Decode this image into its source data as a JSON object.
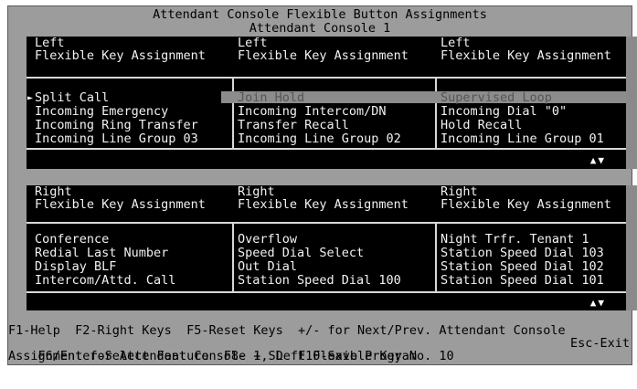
{
  "title": "Attendant Console Flexible Button Assignments",
  "subtitle": "Attendant Console 1",
  "left_panel": {
    "headers": [
      {
        "line1": "Left",
        "line2": "Flexible Key Assignment"
      },
      {
        "line1": "Left",
        "line2": "Flexible Key Assignment"
      },
      {
        "line1": "Left",
        "line2": "Flexible Key Assignment"
      }
    ],
    "columns": [
      [
        "Split Call",
        "Incoming Emergency",
        "Incoming Ring Transfer",
        "Incoming Line Group 03"
      ],
      [
        "Join Hold",
        "Incoming Intercom/DN",
        "Transfer Recall",
        "Incoming Line Group 02"
      ],
      [
        "Supervised Loop",
        "Incoming Dial \"0\"",
        "Hold Recall",
        "Incoming Line Group 01"
      ]
    ],
    "cursor_glyph": "►",
    "scroll_arrows": "▲▼"
  },
  "right_panel": {
    "headers": [
      {
        "line1": "Right",
        "line2": "Flexible Key Assignment"
      },
      {
        "line1": "Right",
        "line2": "Flexible Key Assignment"
      },
      {
        "line1": "Right",
        "line2": "Flexible Key Assignment"
      }
    ],
    "columns": [
      [
        "Conference",
        "Redial Last Number",
        "Display BLF",
        "Intercom/Attd. Call"
      ],
      [
        "Overflow",
        "Speed Dial Select",
        "Out Dial",
        "Station Speed Dial 100"
      ],
      [
        "Night Trfr. Tenant 1",
        "Station Speed Dial 103",
        "Station Speed Dial 102",
        "Station Speed Dial 101"
      ]
    ],
    "scroll_arrows": "▲▼"
  },
  "footer": {
    "line1": "F1-Help  F2-Right Keys  F5-Reset Keys  +/- for Next/Prev. Attendant Console",
    "line2": "F6/Enter-Select Feature  F8- + SD  F10-Save Program",
    "line2_right": "Esc-Exit",
    "status": "Assignment for Attendant Console 1, Left Flexible Key No. 10"
  },
  "colors": {
    "background": "#9c9c9c",
    "panel": "#000000",
    "text": "#f2f2f2",
    "highlight": "#8c8c8c"
  }
}
